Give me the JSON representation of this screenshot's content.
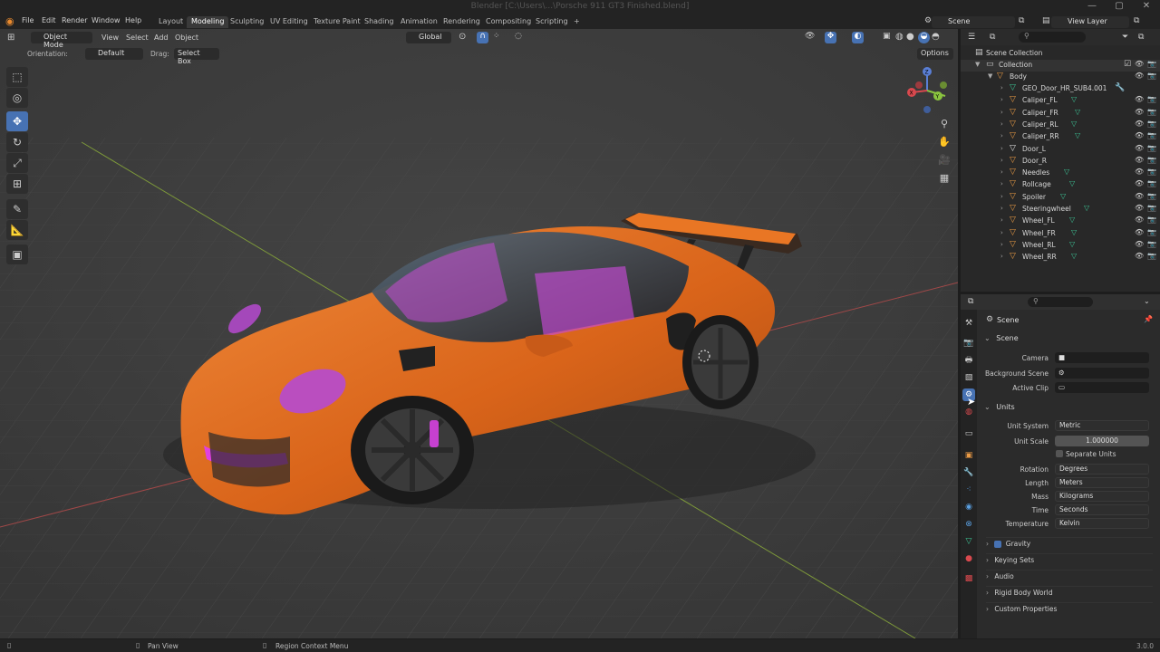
{
  "window": {
    "title": "Blender [C:\\Users\\...\\Porsche 911 GT3 Finished.blend]",
    "minimize": "—",
    "maximize": "▢",
    "close": "✕"
  },
  "menu": [
    "File",
    "Edit",
    "Render",
    "Window",
    "Help"
  ],
  "workspaces": [
    "Layout",
    "Modeling",
    "Sculpting",
    "UV Editing",
    "Texture Paint",
    "Shading",
    "Animation",
    "Rendering",
    "Compositing",
    "Scripting"
  ],
  "workspace_add": "+",
  "scene_field": "Scene",
  "view_layer_field": "View Layer",
  "viewport": {
    "mode": "Object Mode",
    "menus": [
      "View",
      "Select",
      "Add",
      "Object"
    ],
    "transform_orientation": "Global",
    "orientation_label": "Orientation:",
    "orientation_value": "Default",
    "drag_label": "Drag:",
    "drag_value": "Select Box",
    "options": "Options",
    "gizmo": {
      "x": "X",
      "y": "Y",
      "z": "Z"
    }
  },
  "tools": [
    "⬚",
    "◎",
    "✥",
    "↻",
    "⤢",
    "⊞",
    "✎",
    "📐",
    "▣"
  ],
  "outliner": {
    "search_placeholder": "",
    "scene_collection": "Scene Collection",
    "collection": "Collection",
    "body": "Body",
    "items": [
      "GEO_Door_HR_SUB4.001",
      "Caliper_FL",
      "Caliper_FR",
      "Caliper_RL",
      "Caliper_RR",
      "Door_L",
      "Door_R",
      "Needles",
      "Rollcage",
      "Spoiler",
      "Steeringwheel",
      "Wheel_FL",
      "Wheel_FR",
      "Wheel_RL",
      "Wheel_RR"
    ]
  },
  "properties": {
    "context": "Scene",
    "scene_panel": "Scene",
    "camera_label": "Camera",
    "background_scene_label": "Background Scene",
    "active_clip_label": "Active Clip",
    "units_panel": "Units",
    "unit_system_label": "Unit System",
    "unit_system": "Metric",
    "unit_scale_label": "Unit Scale",
    "unit_scale": "1.000000",
    "separate_units": "Separate Units",
    "rotation_label": "Rotation",
    "rotation": "Degrees",
    "length_label": "Length",
    "length": "Meters",
    "mass_label": "Mass",
    "mass": "Kilograms",
    "time_label": "Time",
    "time": "Seconds",
    "temperature_label": "Temperature",
    "temperature": "Kelvin",
    "gravity": "Gravity",
    "keying_sets": "Keying Sets",
    "audio": "Audio",
    "rigid_body_world": "Rigid Body World",
    "custom_properties": "Custom Properties"
  },
  "status": {
    "pan_view": "Pan View",
    "region_context_menu": "Region Context Menu",
    "version": "3.0.0"
  },
  "colors": {
    "accent": "#4772b3",
    "object_orange": "#e99a45",
    "mesh_green": "#3dc495",
    "car_body": "#e06a1c"
  }
}
